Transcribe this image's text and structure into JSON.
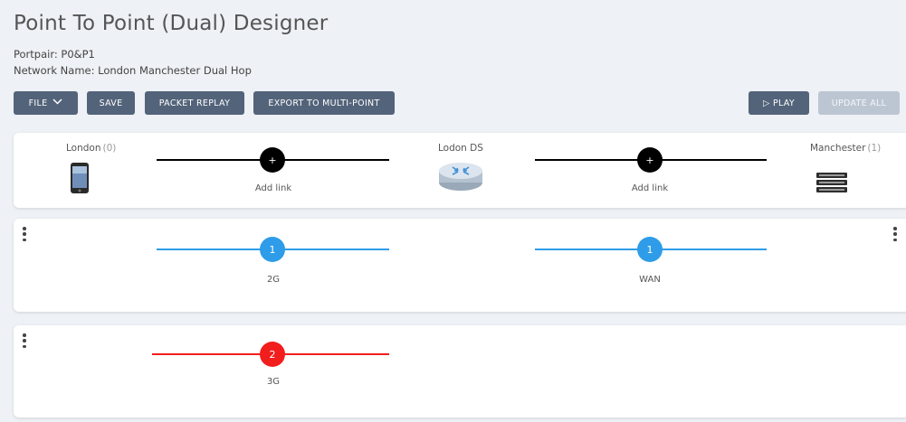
{
  "title": "Point To Point (Dual) Designer",
  "portpair": "Portpair: P0&P1",
  "network_name": "Network Name: London Manchester Dual Hop",
  "toolbar": {
    "file": "FILE",
    "save": "SAVE",
    "packet_replay": "PACKET REPLAY",
    "export": "EXPORT TO MULTI-POINT",
    "play": "▷ PLAY",
    "update_all": "UPDATE ALL"
  },
  "nodes": [
    {
      "name": "London",
      "count": "(0)",
      "icon": "mobile-phone-icon"
    },
    {
      "name": "Lodon DS",
      "count": "",
      "icon": "router-icon"
    },
    {
      "name": "Manchester",
      "count": "(1)",
      "icon": "server-icon"
    }
  ],
  "add_links": [
    {
      "symbol": "+",
      "label": "Add link"
    },
    {
      "symbol": "+",
      "label": "Add link"
    }
  ],
  "link_rows": [
    {
      "links": [
        {
          "count": "1",
          "label": "2G",
          "color": "#2e9ce8"
        },
        {
          "count": "1",
          "label": "WAN",
          "color": "#2e9ce8"
        }
      ]
    },
    {
      "links": [
        {
          "count": "2",
          "label": "3G",
          "color": "#f21d1d"
        }
      ]
    }
  ],
  "colors": {
    "button": "#53637a",
    "button_disabled": "#bcc6d3",
    "link_blue": "#2e9ce8",
    "link_red": "#f21d1d",
    "add_link": "#000000"
  }
}
